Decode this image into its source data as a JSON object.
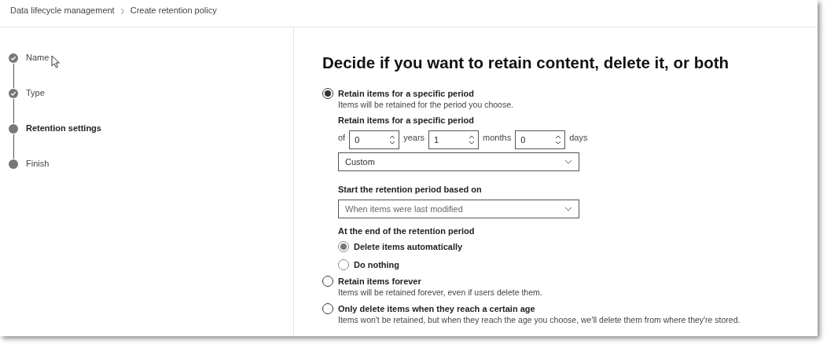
{
  "breadcrumb": [
    {
      "label": "Data lifecycle management"
    },
    {
      "label": "Create retention policy"
    }
  ],
  "steps": [
    {
      "label": "Name",
      "completed": true,
      "selected": false
    },
    {
      "label": "Type",
      "completed": true,
      "selected": false
    },
    {
      "label": "Retention settings",
      "completed": false,
      "selected": true
    },
    {
      "label": "Finish",
      "completed": false,
      "selected": false
    }
  ],
  "heading": "Decide if you want to retain content, delete it, or both",
  "options": [
    {
      "label": "Retain items for a specific period",
      "description": "Items will be retained for the period you choose.",
      "selected": true,
      "details": {
        "period_label": "Retain items for a specific period",
        "of_label": "of",
        "spinners": [
          {
            "value": "0",
            "unit": "years"
          },
          {
            "value": "1",
            "unit": "months"
          },
          {
            "value": "0",
            "unit": "days"
          }
        ],
        "period_dropdown": {
          "value": "Custom"
        },
        "start_label": "Start the retention period based on",
        "start_dropdown": {
          "placeholder": "When items were last modified"
        },
        "end_label": "At the end of the retention period",
        "end_actions": [
          {
            "label": "Delete items automatically",
            "selected": true
          },
          {
            "label": "Do nothing",
            "selected": false
          }
        ]
      }
    },
    {
      "label": "Retain items forever",
      "description": "Items will be retained forever, even if users delete them.",
      "selected": false
    },
    {
      "label": "Only delete items when they reach a certain age",
      "description": "Items won't be retained, but when they reach the age you choose, we'll delete them from where they're stored.",
      "selected": false
    }
  ]
}
